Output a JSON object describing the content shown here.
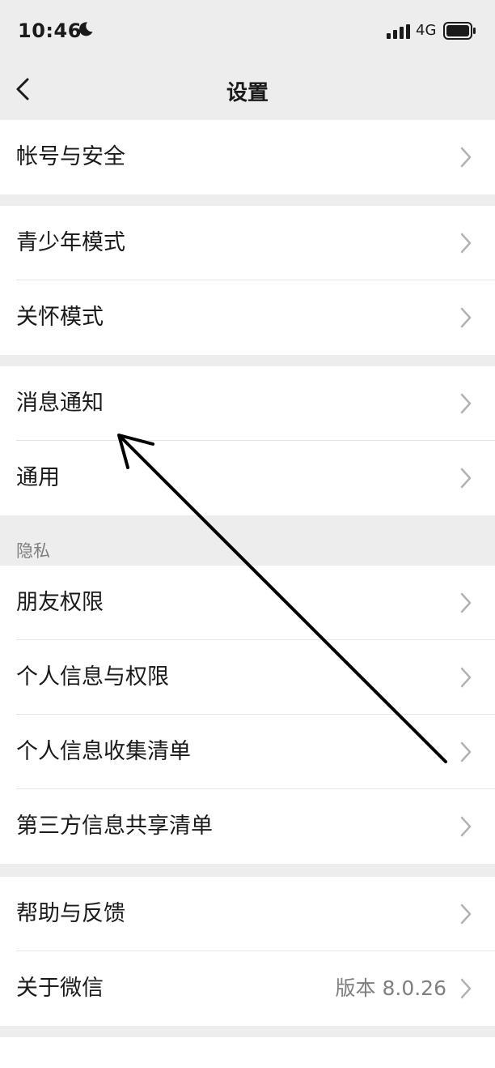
{
  "status": {
    "time": "10:46",
    "network": "4G",
    "icons": [
      "moon-icon",
      "signal-icon",
      "battery-icon"
    ]
  },
  "nav": {
    "title": "设置",
    "back_icon": "chevron-left-icon"
  },
  "groups": [
    {
      "items": [
        {
          "label": "帐号与安全"
        }
      ]
    },
    {
      "items": [
        {
          "label": "青少年模式"
        },
        {
          "label": "关怀模式"
        }
      ]
    },
    {
      "items": [
        {
          "label": "消息通知"
        },
        {
          "label": "通用"
        }
      ]
    },
    {
      "header": "隐私",
      "items": [
        {
          "label": "朋友权限"
        },
        {
          "label": "个人信息与权限"
        },
        {
          "label": "个人信息收集清单"
        },
        {
          "label": "第三方信息共享清单"
        }
      ]
    },
    {
      "items": [
        {
          "label": "帮助与反馈"
        },
        {
          "label": "关于微信",
          "value": "版本 8.0.26"
        }
      ]
    }
  ],
  "colors": {
    "background": "#ededed",
    "card": "#ffffff",
    "secondary_text": "#7f7f7f",
    "annotation_arrow": "#000000"
  }
}
